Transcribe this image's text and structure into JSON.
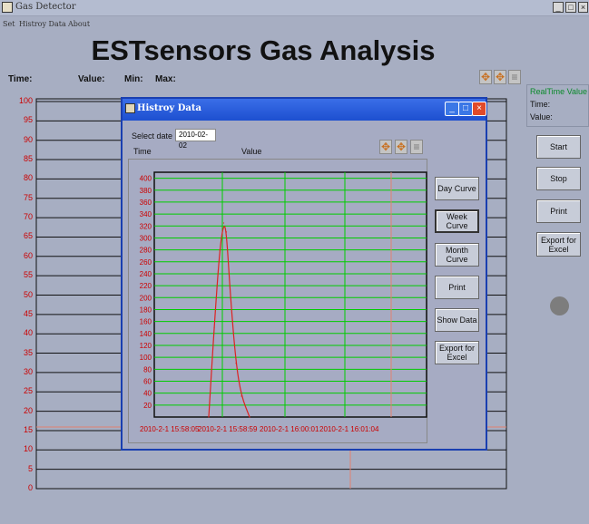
{
  "window": {
    "title": "Gas Detector"
  },
  "menu": [
    "Set",
    "Histroy Data",
    "About"
  ],
  "header": {
    "title": "ESTsensors Gas Analysis",
    "time_label": "Time:",
    "value_label": "Value:",
    "min_label": "Min:",
    "max_label": "Max:"
  },
  "realtime": {
    "title": "RealTime Value",
    "time_label": "Time:",
    "value_label": "Value:"
  },
  "main_buttons": [
    "Start",
    "Stop",
    "Print",
    "Export for Excel"
  ],
  "main_axis": {
    "ticks": [
      100,
      95,
      90,
      85,
      80,
      75,
      70,
      65,
      60,
      55,
      50,
      45,
      40,
      35,
      30,
      25,
      20,
      15,
      10,
      5,
      0
    ],
    "color": "#cc0000"
  },
  "dialog": {
    "title": "Histroy Data",
    "select_date_label": "Select date",
    "date_value": "2010-02-02",
    "col_time": "Time",
    "col_value": "Value",
    "buttons": [
      "Day Curve",
      "Week Curve",
      "Month Curve",
      "Print",
      "Show Data",
      "Export for Excel"
    ],
    "selected_button": "Week Curve"
  },
  "colors": {
    "accent": "#1d4fd0",
    "grid": "#00cc00",
    "curve": "#dd2222",
    "axis_text": "#cc0000"
  },
  "chart_data": {
    "type": "line",
    "y_ticks": [
      400,
      380,
      360,
      340,
      320,
      300,
      280,
      260,
      240,
      220,
      200,
      180,
      160,
      140,
      120,
      100,
      80,
      60,
      40,
      20
    ],
    "ylim": [
      0,
      410
    ],
    "x_tick_labels": [
      "2010-2-1 15:58:05",
      "2010-2-1 15:58:59",
      "2010-2-1 16:00:01",
      "2010-2-1 16:01:04"
    ],
    "series": [
      {
        "points": [
          [
            0.2,
            0
          ],
          [
            0.22,
            150
          ],
          [
            0.24,
            280
          ],
          [
            0.255,
            325
          ],
          [
            0.265,
            310
          ],
          [
            0.28,
            200
          ],
          [
            0.3,
            90
          ],
          [
            0.32,
            35
          ],
          [
            0.35,
            0
          ]
        ]
      }
    ]
  }
}
